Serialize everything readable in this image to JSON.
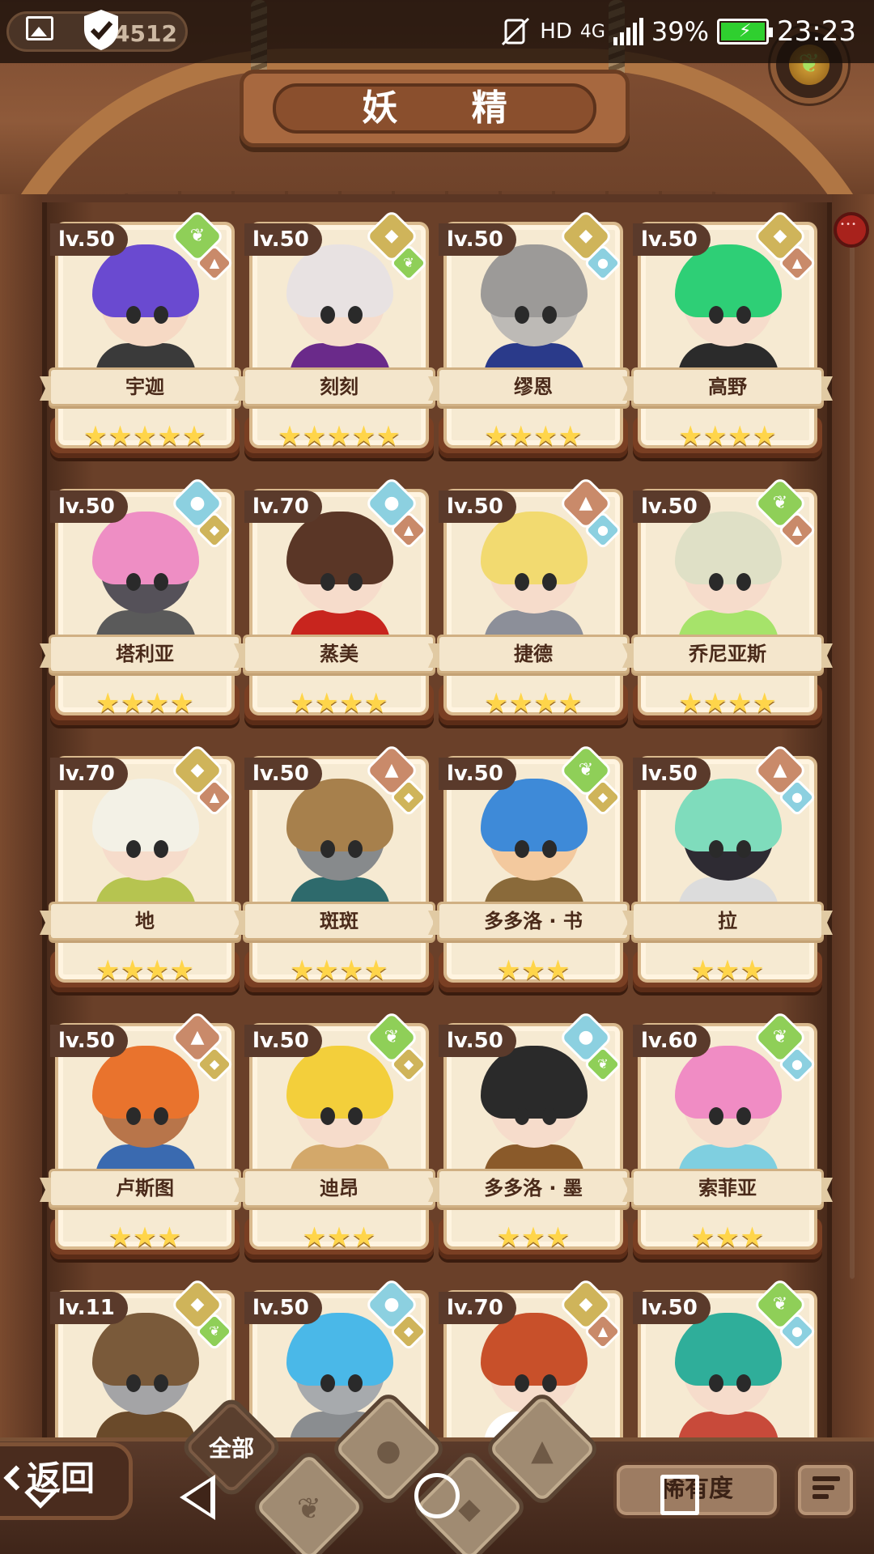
{
  "status_bar": {
    "coin_value": "4512",
    "network_hd": "HD",
    "network_type": "4G",
    "battery": "39%",
    "time": "23:23",
    "icons": [
      "gallery-icon",
      "shield-check-icon",
      "mute-icon",
      "signal-icon",
      "battery-icon"
    ]
  },
  "header": {
    "title": "妖 精",
    "seed_icon": "sprout-icon"
  },
  "element_glyphs": {
    "nature": "❦",
    "earth": "◆",
    "water": "●",
    "fire": "▲"
  },
  "cards": [
    {
      "level": "lv.50",
      "name": "宇迦",
      "stars": "★★★★★",
      "main": "nature",
      "sub": "fire",
      "hair": "#6a4ad0",
      "skin": "#f6d9c4",
      "outfit": "#3a3a3a"
    },
    {
      "level": "lv.50",
      "name": "刻刻",
      "stars": "★★★★★",
      "main": "earth",
      "sub": "nature",
      "hair": "#e8e2e2",
      "skin": "#f6dccb",
      "outfit": "#6a2a8a"
    },
    {
      "level": "lv.50",
      "name": "缪恩",
      "stars": "★★★★",
      "main": "earth",
      "sub": "water",
      "hair": "#9c9a98",
      "skin": "#bdbab6",
      "outfit": "#2a3a8a"
    },
    {
      "level": "lv.50",
      "name": "高野",
      "stars": "★★★★",
      "main": "earth",
      "sub": "fire",
      "hair": "#2ecf76",
      "skin": "#f6dccb",
      "outfit": "#2b2b2b"
    },
    {
      "level": "lv.50",
      "name": "塔利亚",
      "stars": "★★★★",
      "main": "water",
      "sub": "earth",
      "hair": "#ee8ec4",
      "skin": "#555159",
      "outfit": "#5a5a5a"
    },
    {
      "level": "lv.70",
      "name": "蒸美",
      "stars": "★★★★",
      "main": "water",
      "sub": "fire",
      "hair": "#5a3626",
      "skin": "#f6dccb",
      "outfit": "#c8251e"
    },
    {
      "level": "lv.50",
      "name": "捷德",
      "stars": "★★★★",
      "main": "fire",
      "sub": "water",
      "hair": "#f2da70",
      "skin": "#f6dccb",
      "outfit": "#8c8f99"
    },
    {
      "level": "lv.50",
      "name": "乔尼亚斯",
      "stars": "★★★★",
      "main": "nature",
      "sub": "fire",
      "hair": "#dfe0c6",
      "skin": "#f6dccb",
      "outfit": "#a6e36a"
    },
    {
      "level": "lv.70",
      "name": "地",
      "stars": "★★★★",
      "main": "earth",
      "sub": "fire",
      "hair": "#f3f1e6",
      "skin": "#f6dccb",
      "outfit": "#b6c450"
    },
    {
      "level": "lv.50",
      "name": "斑斑",
      "stars": "★★★★",
      "main": "fire",
      "sub": "earth",
      "hair": "#a7804c",
      "skin": "#878a8c",
      "outfit": "#2e6a6c"
    },
    {
      "level": "lv.50",
      "name": "多多洛 · 书",
      "stars": "★★★",
      "main": "nature",
      "sub": "earth",
      "hair": "#3e8ad8",
      "skin": "#f3c99e",
      "outfit": "#8a6a3a"
    },
    {
      "level": "lv.50",
      "name": "拉",
      "stars": "★★★",
      "main": "fire",
      "sub": "water",
      "hair": "#7fdcbc",
      "skin": "#2e2b33",
      "outfit": "#dcdcdc"
    },
    {
      "level": "lv.50",
      "name": "卢斯图",
      "stars": "★★★",
      "main": "fire",
      "sub": "earth",
      "hair": "#e9732d",
      "skin": "#b8754a",
      "outfit": "#3a6ab0"
    },
    {
      "level": "lv.50",
      "name": "迪昂",
      "stars": "★★★",
      "main": "nature",
      "sub": "earth",
      "hair": "#f3cf3b",
      "skin": "#f6dccb",
      "outfit": "#d3a86a"
    },
    {
      "level": "lv.50",
      "name": "多多洛 · 墨",
      "stars": "★★★",
      "main": "water",
      "sub": "nature",
      "hair": "#2a2a2a",
      "skin": "#f6dccb",
      "outfit": "#8a5a2a"
    },
    {
      "level": "lv.60",
      "name": "索菲亚",
      "stars": "★★★",
      "main": "nature",
      "sub": "water",
      "hair": "#f08cc4",
      "skin": "#f6dccb",
      "outfit": "#7fcfe0"
    },
    {
      "level": "lv.11",
      "name": "",
      "stars": "",
      "main": "earth",
      "sub": "nature",
      "hair": "#7a5a3a",
      "skin": "#a4a4a6",
      "outfit": "#6a4a2a"
    },
    {
      "level": "lv.50",
      "name": "",
      "stars": "",
      "main": "water",
      "sub": "earth",
      "hair": "#4ab8e8",
      "skin": "#a7aaad",
      "outfit": "#8a8d90"
    },
    {
      "level": "lv.70",
      "name": "",
      "stars": "",
      "main": "earth",
      "sub": "fire",
      "hair": "#c8502a",
      "skin": "#f6dccb",
      "outfit": "#ffffff"
    },
    {
      "level": "lv.50",
      "name": "",
      "stars": "",
      "main": "nature",
      "sub": "water",
      "hair": "#2fae9a",
      "skin": "#f6dccb",
      "outfit": "#c84a3a"
    }
  ],
  "bottom_bar": {
    "back_label": "返回",
    "filter_all_label": "全部",
    "sort_label": "稀有度",
    "filters": [
      "all",
      "nature",
      "water",
      "earth",
      "fire"
    ]
  },
  "colors": {
    "wood_dark": "#3b2418",
    "wood_mid": "#6a4029",
    "card_bg": "#f6ead2",
    "star": "#ffd54a"
  }
}
